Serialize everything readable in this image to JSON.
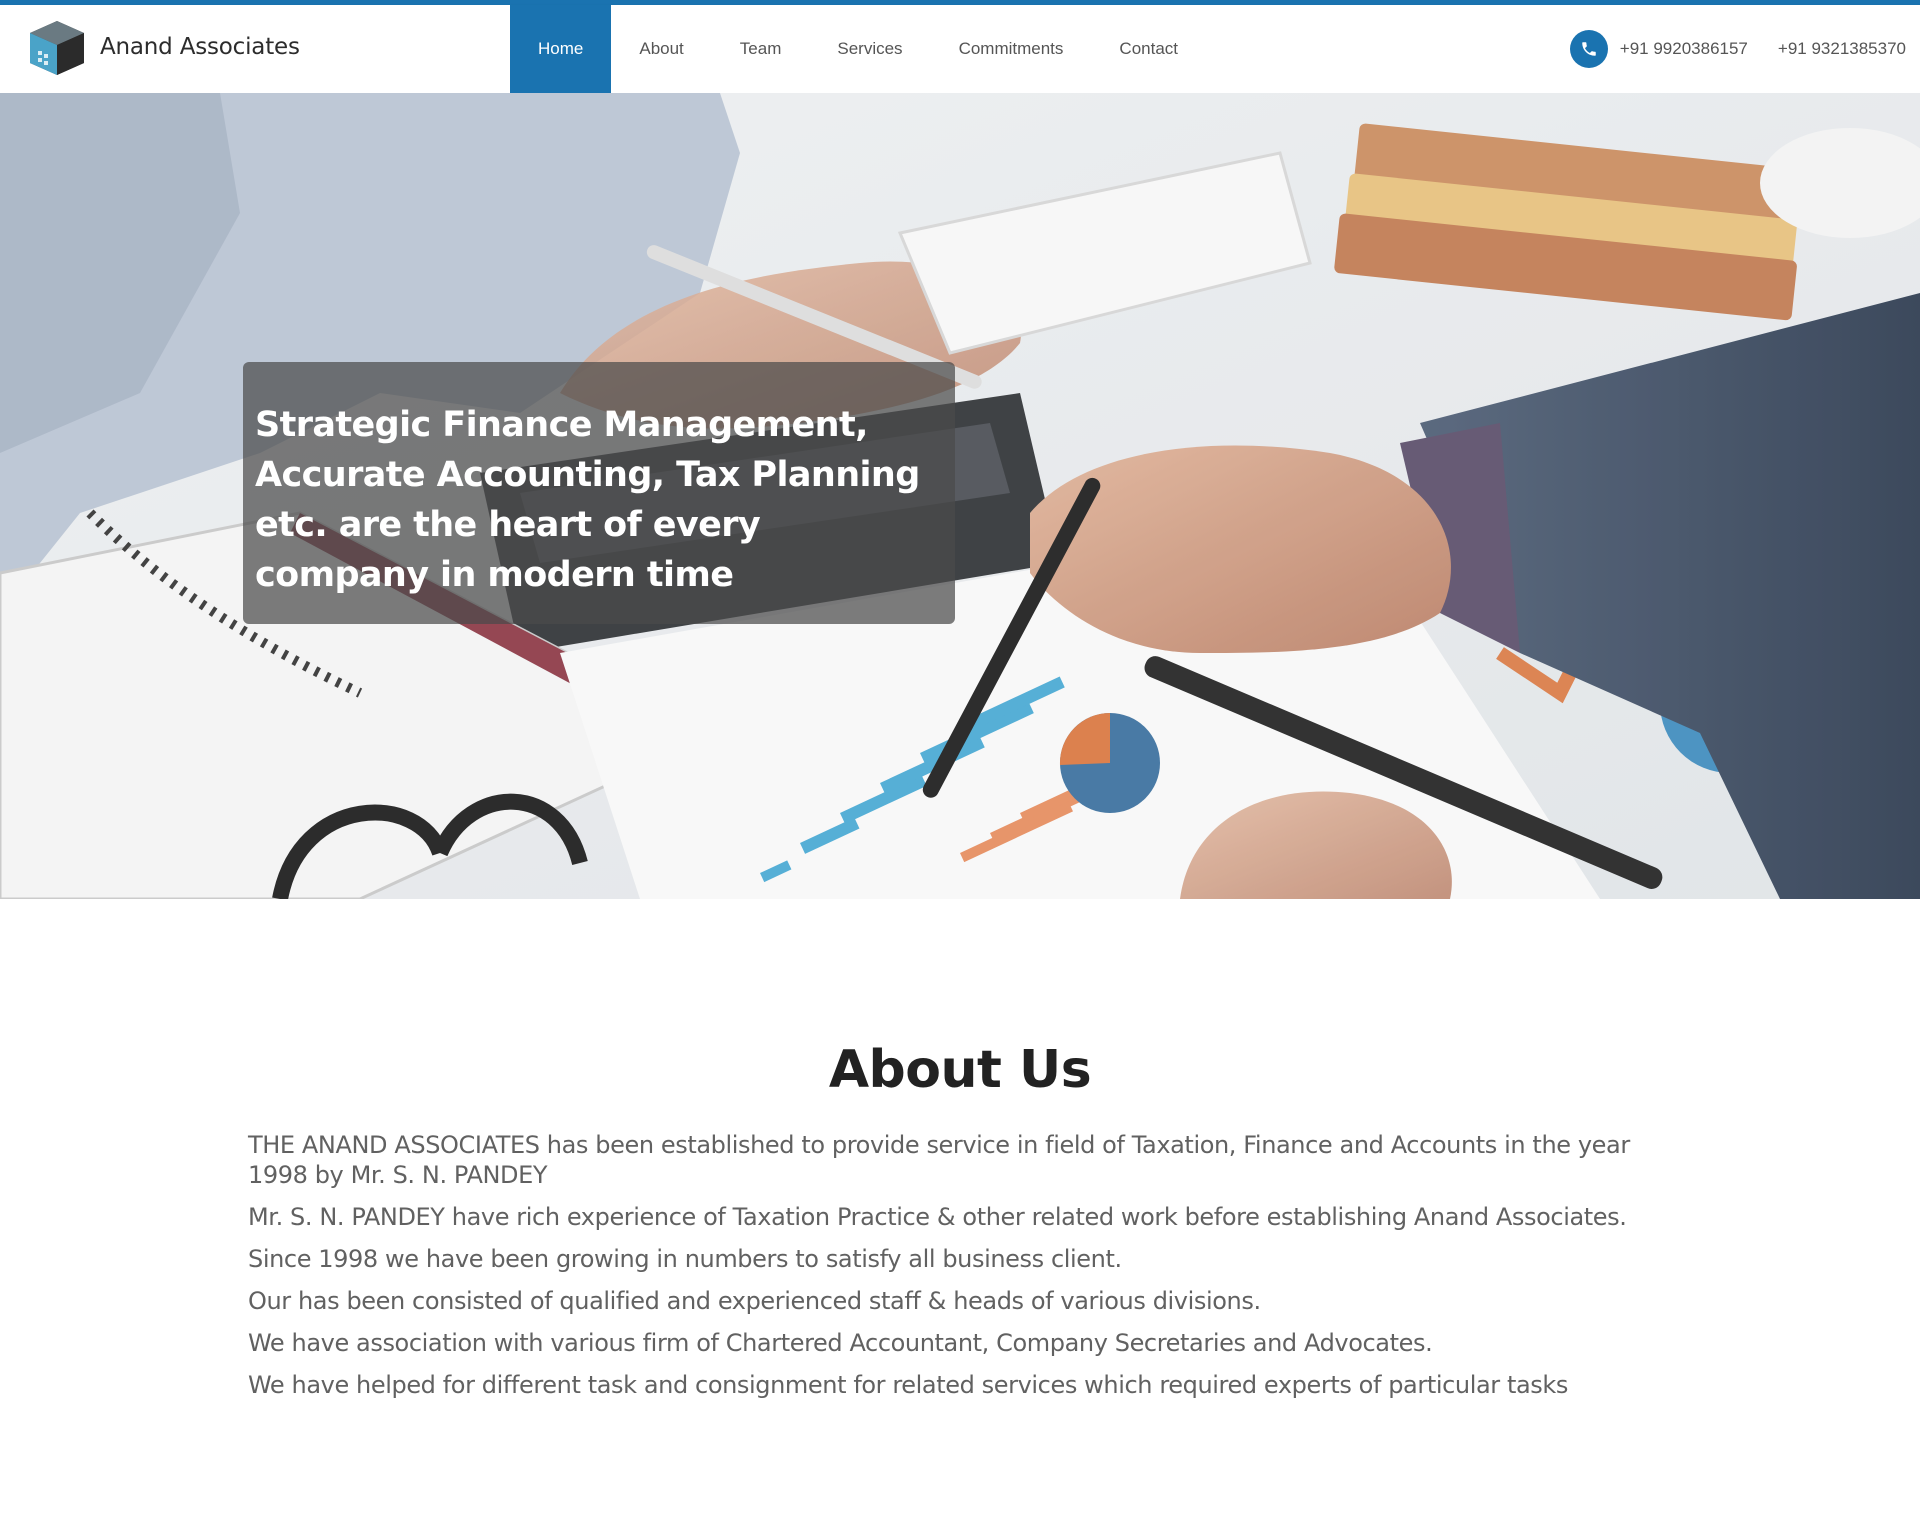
{
  "brand": {
    "name": "Anand Associates",
    "logo_icon": "cube-building-logo"
  },
  "nav": {
    "items": [
      {
        "label": "Home",
        "active": true
      },
      {
        "label": "About",
        "active": false
      },
      {
        "label": "Team",
        "active": false
      },
      {
        "label": "Services",
        "active": false
      },
      {
        "label": "Commitments",
        "active": false
      },
      {
        "label": "Contact",
        "active": false
      }
    ]
  },
  "contact": {
    "icon": "phone-icon",
    "phones": [
      "+91 9920386157",
      "+91 9321385370"
    ]
  },
  "hero": {
    "headline": "Strategic Finance Management, Accurate Accounting, Tax Planning etc. are the heart of every company in modern time"
  },
  "about": {
    "title": "About Us",
    "paragraphs": [
      "THE ANAND ASSOCIATES has been established to provide service in field of Taxation, Finance and Accounts in the year 1998 by Mr. S. N. PANDEY",
      "Mr. S. N. PANDEY have rich experience of Taxation Practice & other related work before establishing Anand Associates.",
      "Since 1998 we have been growing in numbers to satisfy all business client.",
      "Our has been consisted of qualified and experienced staff & heads of various divisions.",
      "We have association with various firm of Chartered Accountant, Company Secretaries and Advocates.",
      "We have helped for different task and consignment for related services which required experts of particular tasks"
    ]
  },
  "colors": {
    "accent": "#1a73b0",
    "text": "#616161",
    "heading": "#222222"
  }
}
